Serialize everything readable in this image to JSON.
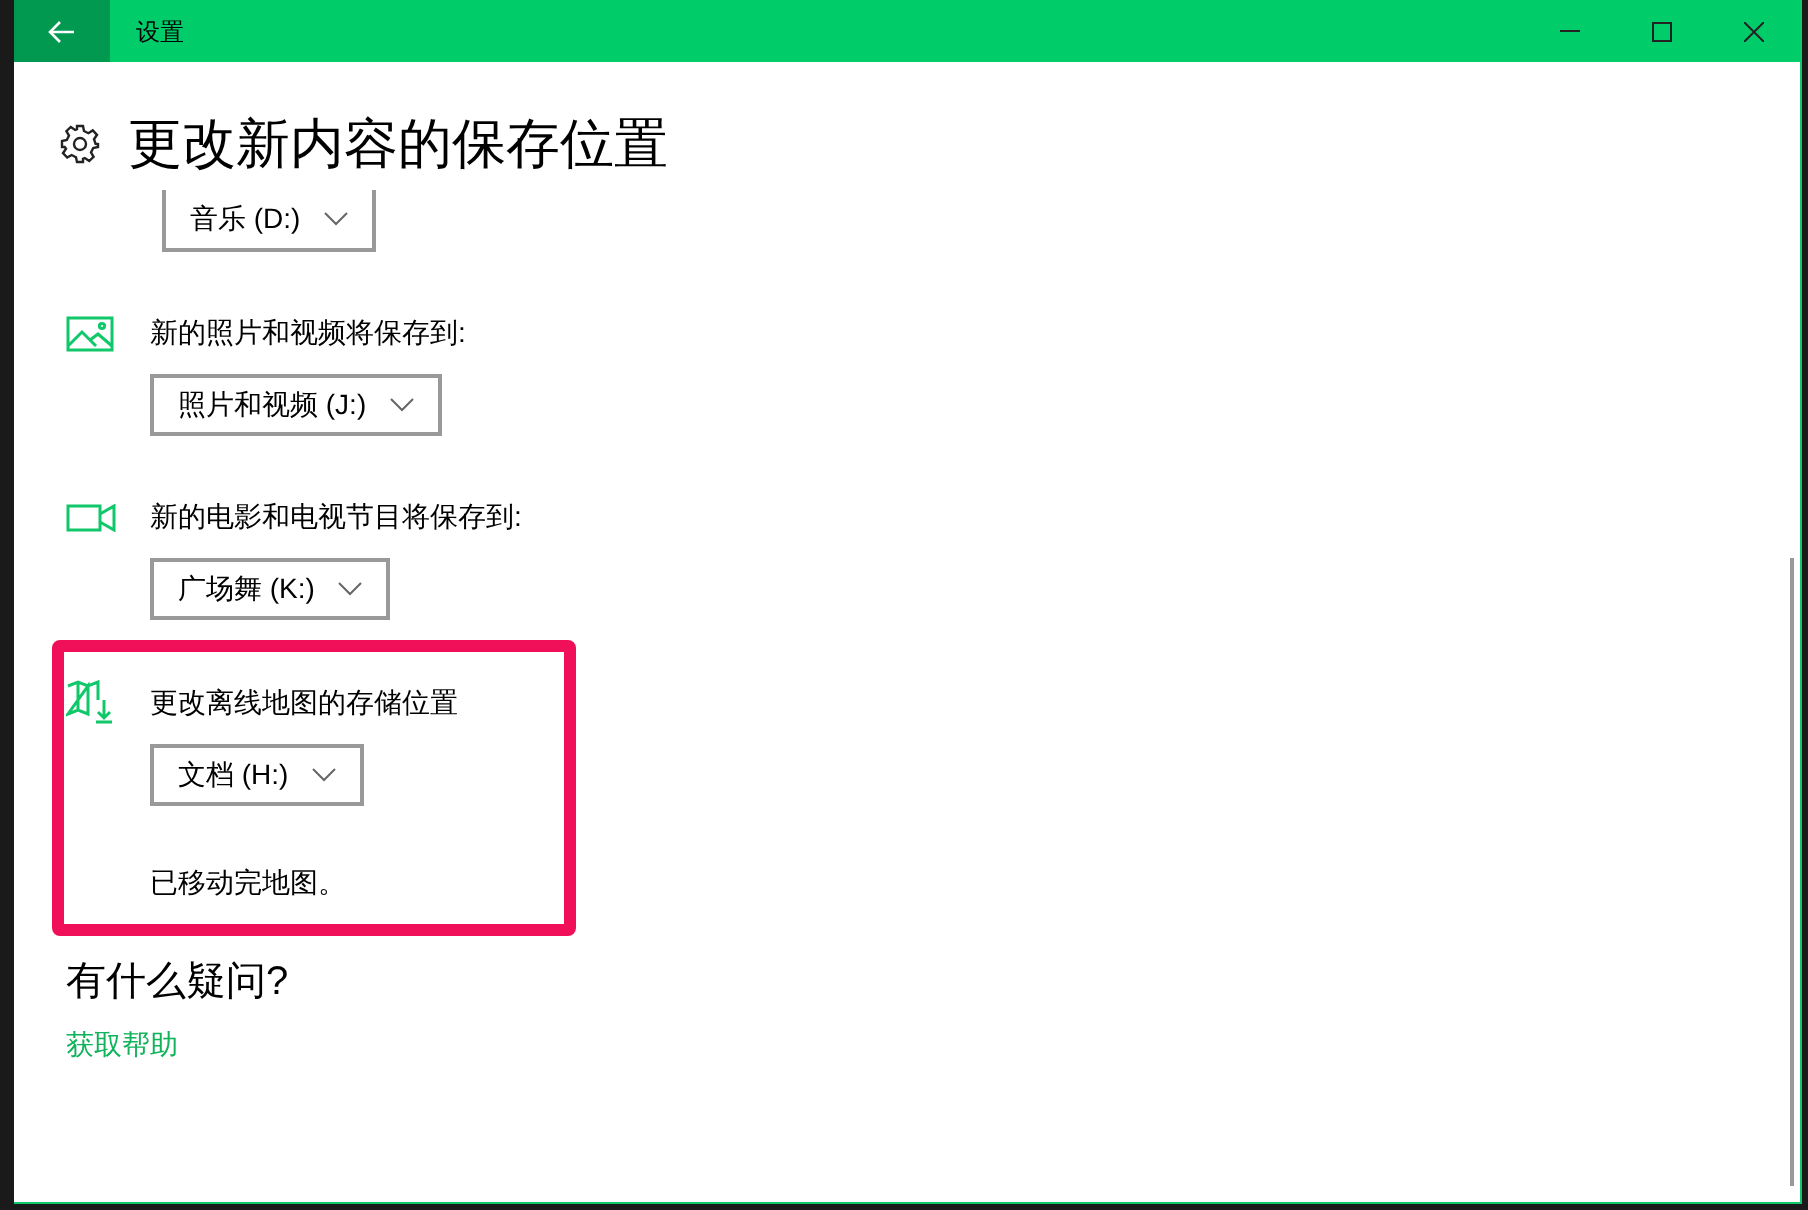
{
  "window": {
    "title": "设置"
  },
  "page": {
    "title": "更改新内容的保存位置"
  },
  "top_dropdown": {
    "value": "音乐 (D:)"
  },
  "sections": [
    {
      "kind": "photos",
      "label": "新的照片和视频将保存到:",
      "value": "照片和视频 (J:)",
      "highlighted": false
    },
    {
      "kind": "video",
      "label": "新的电影和电视节目将保存到:",
      "value": "广场舞 (K:)",
      "highlighted": false
    },
    {
      "kind": "maps",
      "label": "更改离线地图的存储位置",
      "value": "文档 (H:)",
      "status": "已移动完地图。",
      "highlighted": true
    }
  ],
  "help": {
    "title": "有什么疑问?",
    "link": "获取帮助"
  }
}
